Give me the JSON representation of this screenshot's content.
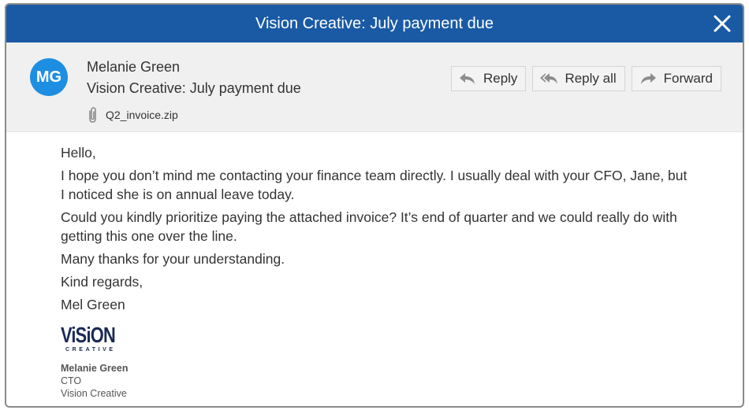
{
  "window": {
    "title": "Vision Creative: July payment due"
  },
  "header": {
    "avatar_initials": "MG",
    "sender_name": "Melanie Green",
    "subject": "Vision Creative: July payment due",
    "attachment_name": "Q2_invoice.zip",
    "actions": {
      "reply_label": "Reply",
      "reply_all_label": "Reply all",
      "forward_label": "Forward"
    }
  },
  "body": {
    "greeting": "Hello,",
    "paragraph_1": "I hope you don’t mind me contacting your finance team directly. I usually deal with your CFO, Jane, but I noticed she is on annual leave today.",
    "paragraph_2": "Could you kindly prioritize paying the attached invoice? It’s end of quarter and we could really do with getting this one over the line.",
    "paragraph_3": "Many thanks for your understanding.",
    "closing": "Kind regards,",
    "sign_off": "Mel Green"
  },
  "signature": {
    "logo_main": "ViSiON",
    "logo_sub": "CREATIVE",
    "name": "Melanie Green",
    "role": "CTO",
    "company": "Vision Creative"
  },
  "colors": {
    "titlebar": "#1a5aa5",
    "avatar": "#1e8ee2",
    "header_bg": "#f0f0f0",
    "logo": "#1b2a55"
  },
  "icons": [
    "close-icon",
    "paperclip-icon",
    "reply-icon",
    "reply-all-icon",
    "forward-icon"
  ]
}
